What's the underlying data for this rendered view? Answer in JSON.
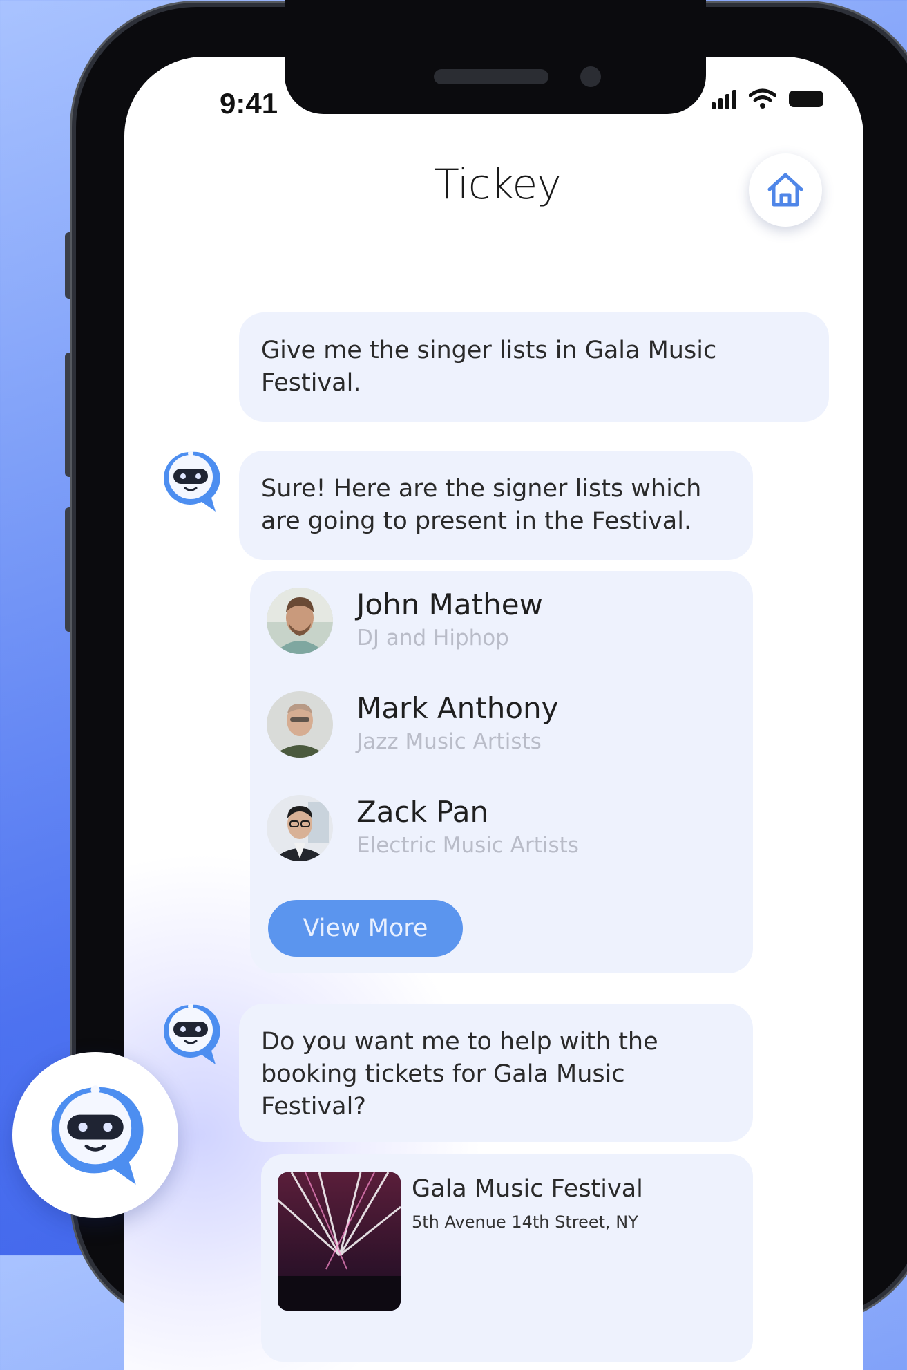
{
  "status_bar": {
    "time": "9:41"
  },
  "header": {
    "title": "Tickey",
    "home_icon": "home-icon"
  },
  "chat": {
    "user_message": "Give me the singer lists in Gala Music Festival.",
    "bot_reply_1": "Sure! Here are the signer lists which are going to present in the Festival.",
    "artists": [
      {
        "name": "John Mathew",
        "genre": "DJ and Hiphop"
      },
      {
        "name": "Mark Anthony",
        "genre": "Jazz Music Artists"
      },
      {
        "name": "Zack Pan",
        "genre": "Electric Music Artists"
      }
    ],
    "view_more_label": "View More",
    "bot_reply_2": "Do you want me to help with the booking tickets for Gala Music Festival?",
    "event": {
      "title": "Gala Music Festival",
      "address": "5th Avenue 14th Street, NY"
    }
  },
  "colors": {
    "accent": "#5b95ee",
    "bubble": "#eef2fd",
    "background_gradient_start": "#a9c3ff",
    "background_gradient_end": "#3a5fe8"
  }
}
